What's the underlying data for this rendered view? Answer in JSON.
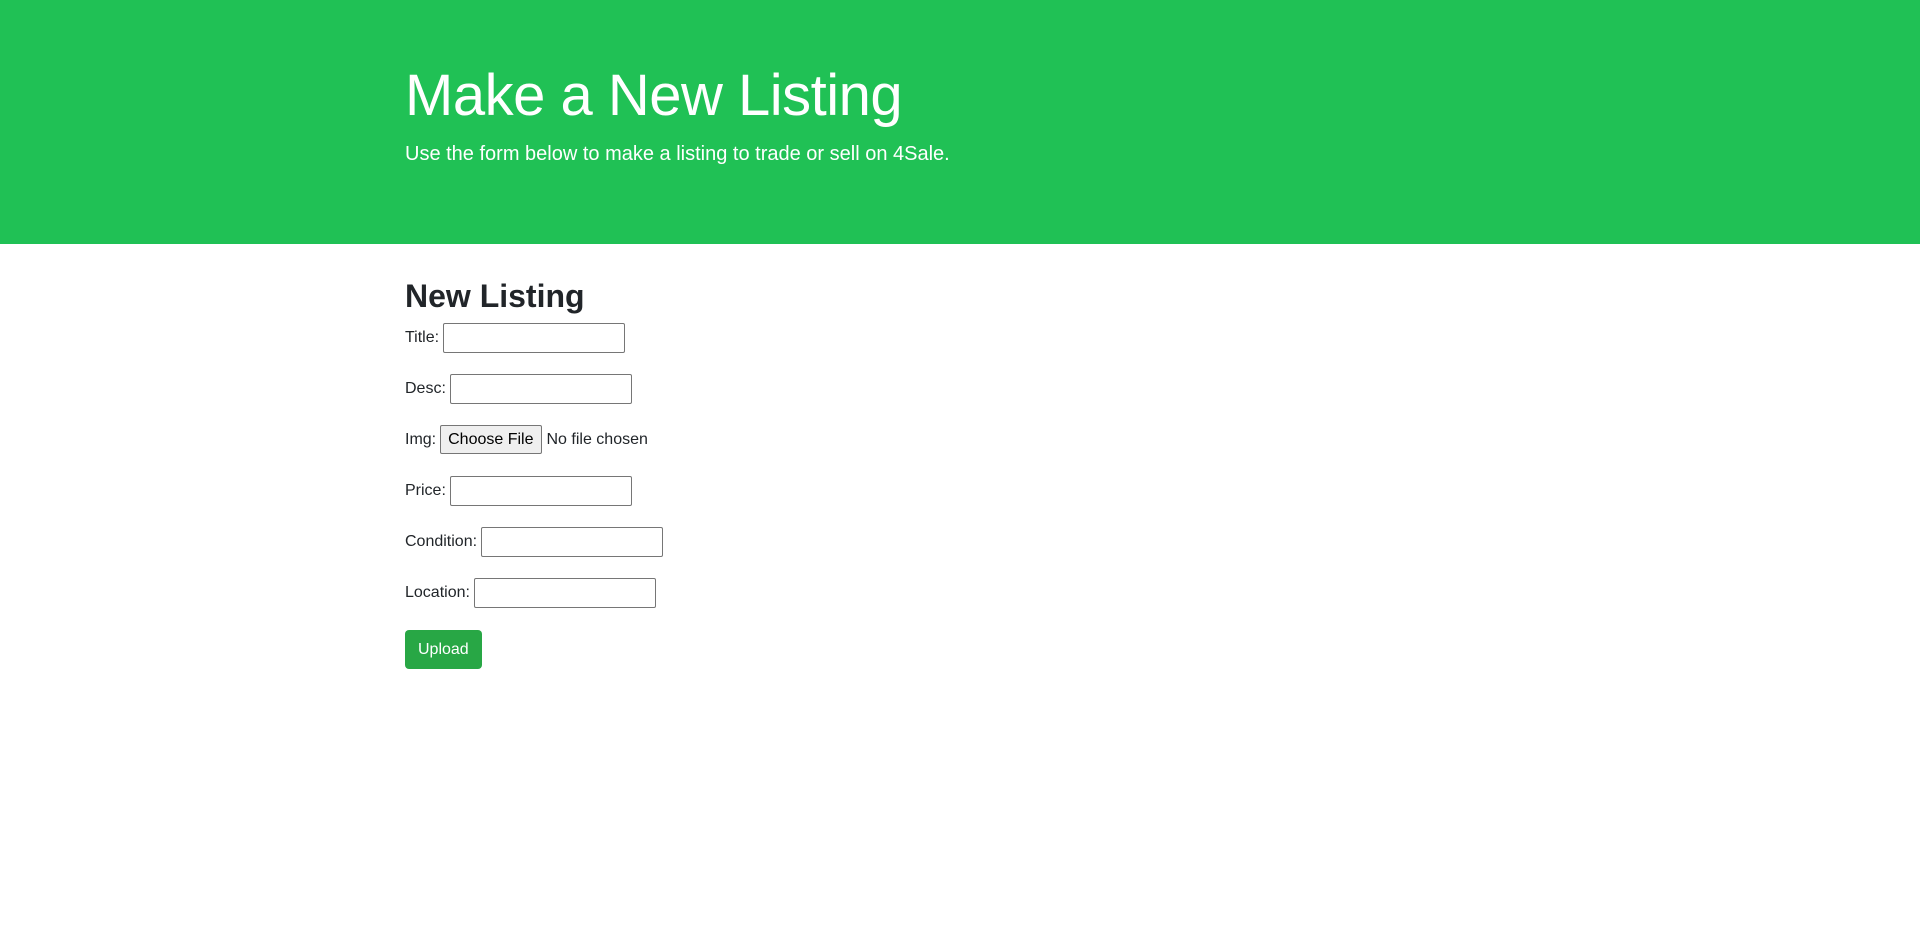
{
  "header": {
    "title": "Make a New Listing",
    "lead": "Use the form below to make a listing to trade or sell on 4Sale."
  },
  "form": {
    "heading": "New Listing",
    "fields": {
      "title": {
        "label": "Title:",
        "value": ""
      },
      "desc": {
        "label": "Desc:",
        "value": ""
      },
      "img": {
        "label": "Img:",
        "button_label": "Choose File",
        "status": "No file chosen"
      },
      "price": {
        "label": "Price:",
        "value": ""
      },
      "condition": {
        "label": "Condition:",
        "value": ""
      },
      "location": {
        "label": "Location:",
        "value": ""
      }
    },
    "submit_label": "Upload"
  },
  "colors": {
    "jumbotron_bg": "#20c155",
    "button_bg": "#28a745"
  }
}
